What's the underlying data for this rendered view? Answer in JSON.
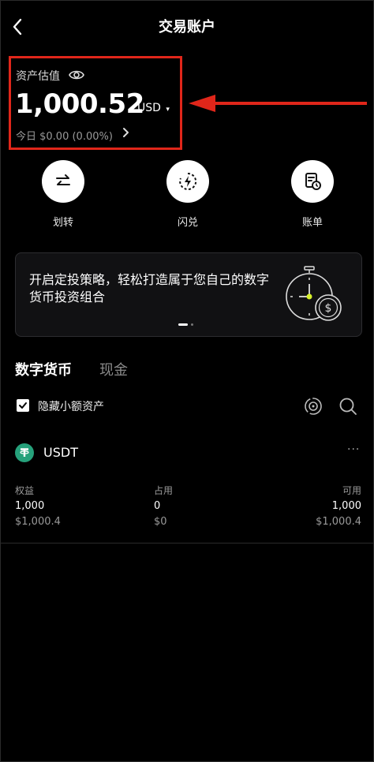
{
  "header": {
    "title": "交易账户",
    "back_icon": "chevron-left-icon"
  },
  "assets": {
    "label": "资产估值",
    "eye_icon": "eye-icon",
    "balance": "1,000.52",
    "currency": "USD",
    "today": "今日 $0.00 (0.00%)",
    "highlight_color": "#e0261a"
  },
  "actions": [
    {
      "label": "划转",
      "icon": "swap-arrows-icon"
    },
    {
      "label": "闪兑",
      "icon": "flash-exchange-icon"
    },
    {
      "label": "账单",
      "icon": "bill-icon"
    }
  ],
  "banner": {
    "text": "开启定投策略，轻松打造属于您自己的数字货币投资组合",
    "illustration": "stopwatch-coin-icon"
  },
  "tabs": [
    {
      "label": "数字货币",
      "active": true
    },
    {
      "label": "现金",
      "active": false
    }
  ],
  "filter": {
    "hide_small_label": "隐藏小额资产",
    "checked": true
  },
  "asset_row": {
    "name": "USDT",
    "icon": "tether-icon",
    "icon_color": "#26a17b",
    "equity_label": "权益",
    "equity_value": "1,000",
    "equity_usd": "$1,000.4",
    "occupied_label": "占用",
    "occupied_value": "0",
    "occupied_usd": "$0",
    "available_label": "可用",
    "available_value": "1,000",
    "available_usd": "$1,000.4"
  }
}
